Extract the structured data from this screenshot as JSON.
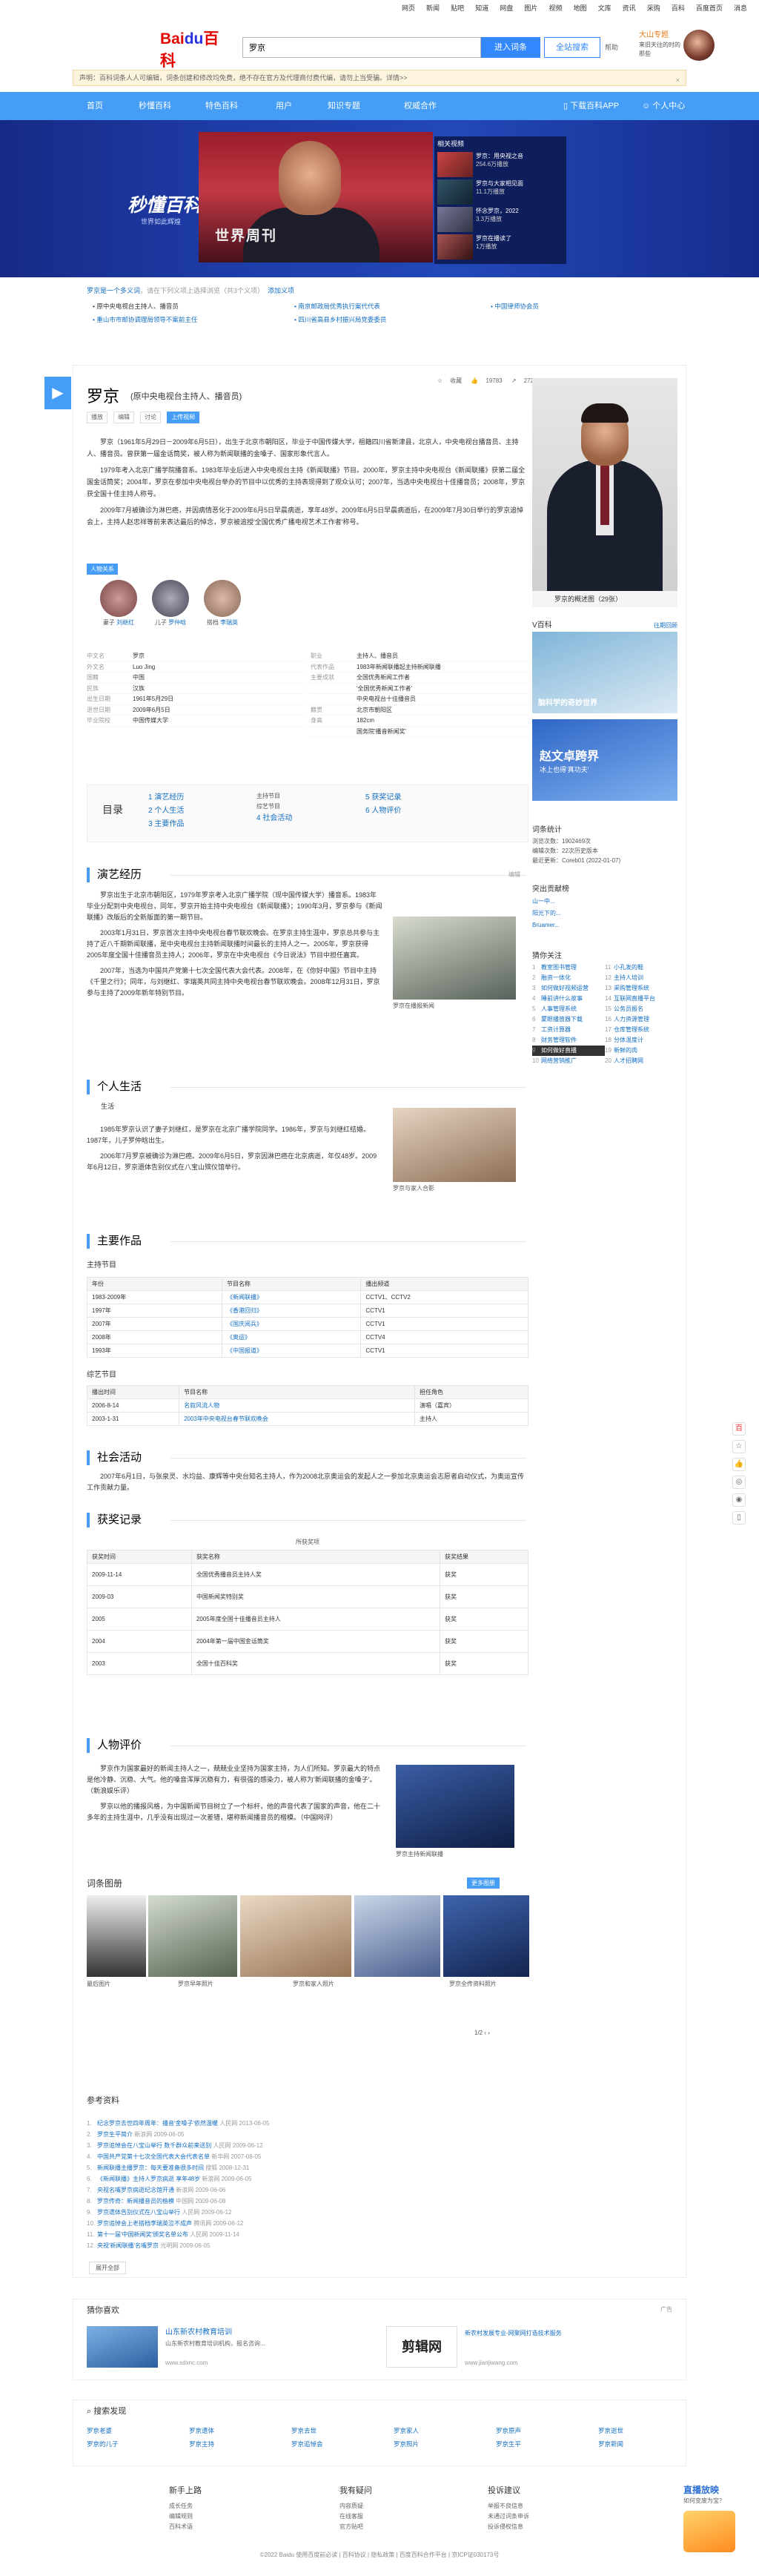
{
  "topnav": [
    "网页",
    "新闻",
    "贴吧",
    "知道",
    "网盘",
    "图片",
    "视频",
    "地图",
    "文库",
    "资讯",
    "采购",
    "百科",
    "百度首页",
    "消息"
  ],
  "logo": {
    "text1": "Bai",
    "text2": "du",
    "text3": "百科"
  },
  "search": {
    "value": "罗京",
    "enter_label": "进入词条",
    "search_label": "全站搜索",
    "help_label": "帮助"
  },
  "user": {
    "name": "大山专题",
    "sub": "来旧天往的时的那些"
  },
  "notice": {
    "text": "声明：百科词条人人可编辑，词条创建和修改均免费，绝不存在官方及代理商付费代编，请勿上当受骗。详情>>",
    "close": "×"
  },
  "mainnav": {
    "items": [
      "首页",
      "秒懂百科",
      "特色百科",
      "用户",
      "知识专题",
      "权威合作"
    ],
    "app": "下载百科APP",
    "center": "个人中心"
  },
  "banner": {
    "logo": "秒懂百科",
    "logo_sub": "世界如此辉煌",
    "tv_text": "世界周刊",
    "related_title": "相关视频",
    "videos": [
      {
        "title": "罗京：用央视之音",
        "sub": "254.6万播放"
      },
      {
        "title": "罗京与大家相见面",
        "sub": "11.1万播放"
      },
      {
        "title": "怀念罗京，2022",
        "sub": "3.3万播放"
      },
      {
        "title": "罗京在播读了",
        "sub": "1万播放"
      }
    ]
  },
  "breadcrumb": {
    "a": "罗京是一个多义词",
    "b": "，请在下列义项上选择浏览（共3个义项）",
    "c": "添加义项"
  },
  "senses": [
    "• 原中央电视台主持人、播音员",
    "• 南京邮政局优秀执行案代代表",
    "• 中国律师协会员",
    "• 重山市市邮协调理局领导不案前主任",
    "• 四川省高县乡村振兴局党委委员"
  ],
  "entry": {
    "name": "罗京",
    "desc": "(原中央电视台主持人、播音员)",
    "tools": [
      "播放",
      "编辑",
      "讨论",
      "上传视频"
    ],
    "stats": {
      "collect": "收藏",
      "likes": "19783",
      "shares": "272"
    }
  },
  "summary": [
    "罗京（1961年5月29日－2009年6月5日），出生于北京市朝阳区，毕业于中国传媒大学，祖籍四川省新津县，北京人，中央电视台播音员、主持人、播音员。曾获第一届金话筒奖，被人称为新闻联播的金嗓子、国家形象代言人。",
    "1979年考入北京广播学院播音系。1983年毕业后进入中央电视台主持《新闻联播》节目。2000年，罗京主持中央电视台《新闻联播》获第二届全国金话筒奖；2004年，罗京在参加中央电视台举办的节目中以优秀的主持表现得到了观众认可；2007年，当选中央电视台十佳播音员；2008年，罗京获全国十佳主持人称号。",
    "2009年7月被确诊为淋巴癌，并因病情恶化于2009年6月5日早晨病逝，享年48岁。2009年6月5日早晨病逝后，在2009年7月30日举行的罗京追悼会上，主持人赵忠祥等前来表达最后的悼念，罗京被追授'全国优秀广播电视艺术工作者'称号。"
  ],
  "relations": {
    "label": "人物关系",
    "people": [
      {
        "role": "妻子",
        "name": "刘继红"
      },
      {
        "role": "儿子",
        "name": "罗仲晗"
      },
      {
        "role": "搭档",
        "name": "李瑞英"
      }
    ]
  },
  "info_left": [
    {
      "k": "中文名",
      "v": "罗京"
    },
    {
      "k": "外文名",
      "v": "Luo Jing"
    },
    {
      "k": "国籍",
      "v": "中国"
    },
    {
      "k": "民族",
      "v": "汉族"
    },
    {
      "k": "出生日期",
      "v": "1961年5月29日"
    },
    {
      "k": "逝世日期",
      "v": "2009年6月5日"
    },
    {
      "k": "毕业院校",
      "v": "中国传媒大学"
    }
  ],
  "info_right": [
    {
      "k": "职业",
      "v": "主持人、播音员"
    },
    {
      "k": "代表作品",
      "v": "1983年新闻联播起主持新闻联播"
    },
    {
      "k": "主要成就",
      "v": "全国优秀新闻工作者"
    },
    {
      "k": "",
      "v": "'全国优秀新闻工作者'"
    },
    {
      "k": "",
      "v": "中央电视台十佳播音员"
    },
    {
      "k": "籍贯",
      "v": "北京市朝阳区"
    },
    {
      "k": "身高",
      "v": "182cm"
    },
    {
      "k": "",
      "v": "国务院'播音新闻奖'"
    }
  ],
  "toc": {
    "label": "目录",
    "items": [
      "1 演艺经历",
      "2 个人生活",
      "3 主要作品",
      "4 社会活动",
      "5 获奖记录",
      "6 人物评价"
    ],
    "sub": [
      "主持节目",
      "综艺节目"
    ]
  },
  "sec1": {
    "title": "演艺经历",
    "edit": "编辑",
    "paras": [
      "罗京出生于北京市朝阳区，1979年罗京考入北京广播学院（现中国传媒大学）播音系。1983年毕业分配到中央电视台，同年，罗京开始主持中央电视台《新闻联播》；1990年3月，罗京参与《新闻联播》改版后的全新版面的第一期节目。",
      "2003年1月31日，罗京首次主持中央电视台春节联欢晚会。在罗京主持生涯中，罗京总共参与主持了近八千期新闻联播，是中央电视台主持新闻联播时间最长的主持人之一。2005年，罗京获得2005年度全国十佳播音员主持人；2006年，罗京在中央电视台《今日说法》节目中担任嘉宾。",
      "2007年，当选为中国共产党第十七次全国代表大会代表。2008年，在《你好中国》节目中主持《千里之行》；同年，与刘继红、李瑞英共同主持中央电视台春节联欢晚会。2008年12月31日，罗京参与主持了2009年新年特别节目。"
    ],
    "photo_cap": "罗京在播报新闻"
  },
  "sec2": {
    "title": "个人生活",
    "sub": "生活",
    "paras": [
      "1985年罗京认识了妻子刘继红，是罗京在北京广播学院同学。1986年，罗京与刘继红结婚。1987年，儿子罗仲晗出生。",
      "2006年7月罗京被确诊为淋巴癌。2009年6月5日，罗京因淋巴癌在北京病逝，年仅48岁。2009年6月12日，罗京遗体告别仪式在八宝山殡仪馆举行。"
    ],
    "photo_cap": "罗京与家人合影"
  },
  "sec3": {
    "title": "主要作品",
    "sub1": "主持节目",
    "head1": [
      "年份",
      "节目名称",
      "播出频道"
    ],
    "rows1": [
      [
        "1983-2009年",
        "《新闻联播》",
        "CCTV1、CCTV2"
      ],
      [
        "1997年",
        "《香港回归》",
        "CCTV1"
      ],
      [
        "2007年",
        "《国庆阅兵》",
        "CCTV1"
      ],
      [
        "2008年",
        "《奥运》",
        "CCTV4"
      ],
      [
        "1993年",
        "《中国报道》",
        "CCTV1"
      ]
    ],
    "sub2": "综艺节目",
    "head2": [
      "播出时间",
      "节目名称",
      "担任角色"
    ],
    "rows2": [
      [
        "2006-8-14",
        "名叙风流人物",
        "演唱（嘉宾）"
      ],
      [
        "2003-1-31",
        "2003年中央电视台春节联欢晚会",
        "主持人"
      ]
    ]
  },
  "sec4": {
    "title": "社会活动",
    "text": "2007年6月1日，与张泉灵、水均益、康辉等中央台知名主持人，作为2008北京奥运会的发起人之一参加北京奥运会志愿者启动仪式，为奥运宣传工作贡献力量。"
  },
  "sec5": {
    "title": "获奖记录",
    "caption": "所获奖项",
    "head": [
      "获奖时间",
      "获奖名称",
      "获奖结果"
    ],
    "rows": [
      [
        "2009-11-14",
        "全国优秀播音员主持人奖",
        "获奖"
      ],
      [
        "2009-03",
        "中国新闻奖特别奖",
        "获奖"
      ],
      [
        "2005",
        "2005年度全国十佳播音员主持人",
        "获奖"
      ],
      [
        "2004",
        "2004年第一届中国金话筒奖",
        "获奖"
      ],
      [
        "2003",
        "全国十佳百科奖",
        "获奖"
      ]
    ]
  },
  "sec6": {
    "title": "人物评价",
    "paras": [
      "罗京作为国家最好的新闻主持人之一，兢兢业业坚持为国家主持，为人们所知。罗京最大的特点是他冷静、沉稳、大气。他的嗓音浑厚沉稳有力，有很强的感染力，被人称为'新闻联播的金嗓子'。（新浪娱乐评）",
      "罗京以他的播报风格，为中国新闻节目树立了一个标杆，他的声音代表了国家的声音，他在二十多年的主持生涯中，几乎没有出现过一次差错，堪称新闻播音员的楷模。（中国网评）"
    ],
    "photo_cap": "罗京主持新闻联播"
  },
  "gallery": {
    "title": "词条图册",
    "more": "更多图册",
    "captions": [
      "最后图片",
      "罗京早年照片",
      "罗京和家人照片",
      "罗京全传资料照片"
    ],
    "page": "1/2"
  },
  "refs": {
    "title": "参考资料",
    "items": [
      {
        "t": "纪念罗京去世四年周年：播音'金嗓子'依然温暖",
        "m": "人民网 2013-06-05"
      },
      {
        "t": "罗京生平简介",
        "m": "新浪网 2009-06-05"
      },
      {
        "t": "罗京追悼会在八宝山举行 数千群众前来送别",
        "m": "人民网 2009-06-12"
      },
      {
        "t": "中国共产党第十七次全国代表大会代表名单",
        "m": "新华网 2007-08-05"
      },
      {
        "t": "新闻联播主播罗京：每天要准备很多时间",
        "m": "搜狐 2008-12-31"
      },
      {
        "t": "《新闻联播》主持人罗京病逝 享年48岁",
        "m": "新浪网 2009-06-05"
      },
      {
        "t": "央视名嘴罗京病逝纪念馆开通",
        "m": "新浪网 2009-06-06"
      },
      {
        "t": "罗京传奇：新闻播音员的楷模",
        "m": "中国网 2009-06-08"
      },
      {
        "t": "罗京遗体告别仪式在八宝山举行",
        "m": "人民网 2009-06-12"
      },
      {
        "t": "罗京追悼会上老搭档李瑞英泣不成声",
        "m": "腾讯网 2009-06-12"
      },
      {
        "t": "第十一届'中国新闻奖'颁奖名单公布",
        "m": "人民网 2009-11-14"
      },
      {
        "t": "央视'新闻联播'名嘴罗京",
        "m": "光明网 2009-06-05"
      }
    ],
    "more": "展开全部"
  },
  "sidebar": {
    "album": "罗京的概述图（29张）",
    "promo_title": "V百科",
    "promo_more": "往期回顾",
    "ad1_text": "脑科学的奇妙世界",
    "ad2_title": "赵文卓跨界",
    "ad2_sub": "冰上也得'真功夫'",
    "contrib_title": "词条统计",
    "contrib": [
      "浏览次数：1902469次",
      "编辑次数：22次历史版本",
      "最近更新：Coreb01 (2022-01-07)"
    ],
    "rel_title": "突出贡献榜",
    "rel_people": [
      "山一中...",
      "阳光下的...",
      "Bruamer..."
    ],
    "list_title": "猜你关注",
    "list_left": [
      "教室图书管理",
      "融资一体化",
      "如何做好视频运营",
      "睡前讲什么故事",
      "人事管理系统",
      "蒙眼播放器下载",
      "工资计算器",
      "财务管理软件",
      "如何做好直播",
      "网络营销推广"
    ],
    "list_right": [
      "小孔发的鞋",
      "主持人培训",
      "采购管理系统",
      "互联网直播平台",
      "公务员报名",
      "人力资源管理",
      "仓库管理系统",
      "分体温度计",
      "新鲜的肉",
      "人才招聘网"
    ]
  },
  "recommend": {
    "title": "猜你喜欢",
    "tag": "广告",
    "left_title": "山东新农村教育培训",
    "left_desc": "山东新农村教育培训机构，报名咨询...",
    "left_url": "www.sdxnc.com",
    "right_title": "剪辑网",
    "right_desc": "新农村发展专业-网聚网打造技术服务",
    "right_url": "www.jianjiwang.com"
  },
  "discover": {
    "title": "搜索发现",
    "cols": [
      [
        "罗京老婆",
        "罗京的儿子"
      ],
      [
        "罗京遗体",
        "罗京主持"
      ],
      [
        "罗京去世",
        "罗京追悼会"
      ],
      [
        "罗京家人",
        "罗京照片"
      ],
      [
        "罗京原声",
        "罗京生平"
      ],
      [
        "罗京逝世",
        "罗京新闻"
      ]
    ]
  },
  "footer": {
    "cols": [
      {
        "h": "新手上路",
        "links": [
          "成长任务",
          "编辑规则",
          "百科术语"
        ]
      },
      {
        "h": "我有疑问",
        "links": [
          "内容质疑",
          "在线客服",
          "官方贴吧"
        ]
      },
      {
        "h": "投诉建议",
        "links": [
          "举报不良信息",
          "未通过词条申诉",
          "投诉侵权信息"
        ]
      }
    ],
    "copyright": "©2022 Baidu 使用百度前必读 | 百科协议 | 隐私政策 | 百度百科合作平台 | 京ICP证030173号"
  },
  "goodbox": {
    "title": "直播放映",
    "sub": "如何变废为宝？"
  }
}
